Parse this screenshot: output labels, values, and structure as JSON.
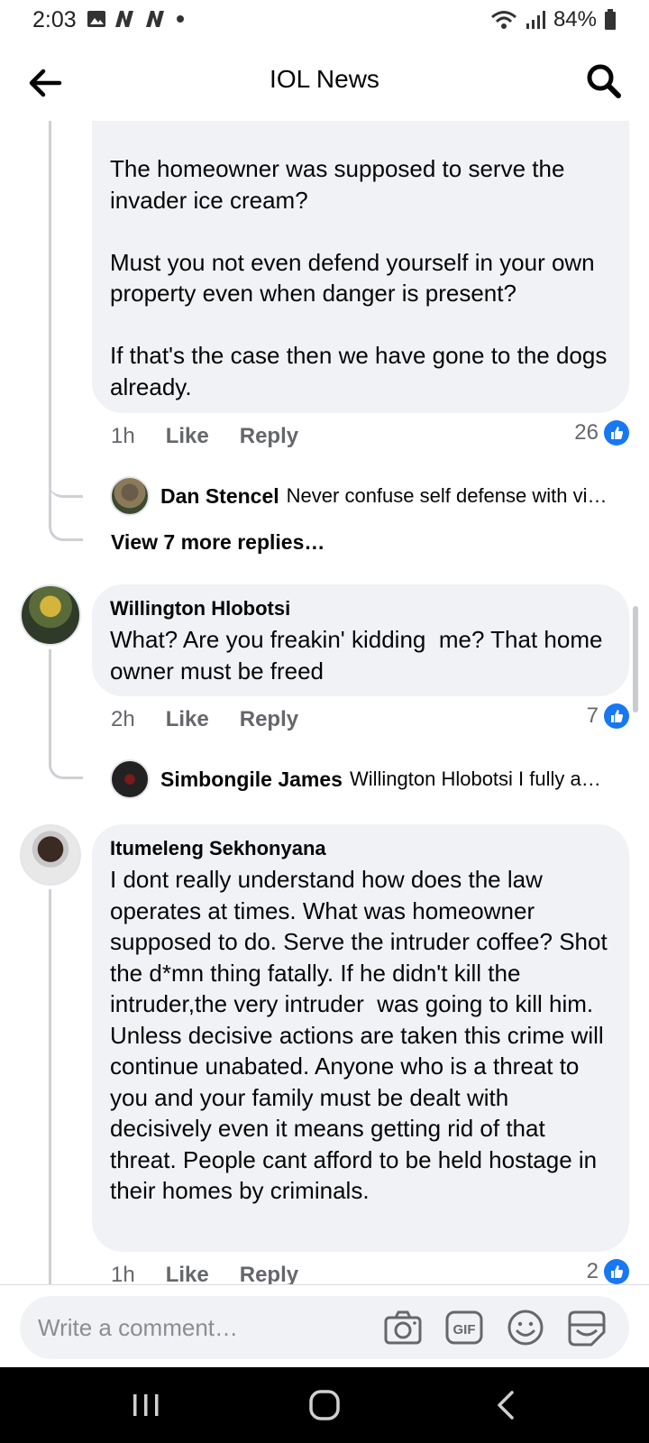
{
  "status_bar": {
    "time": "2:03",
    "battery": "84%"
  },
  "header": {
    "title": "IOL News"
  },
  "comment1": {
    "text": "The homeowner was supposed to serve the invader ice cream?\n\nMust you not even defend yourself in your own property even when danger is present?\n\nIf that's the case then we have gone to the dogs already.",
    "time": "1h",
    "like": "Like",
    "reply": "Reply",
    "reactions": "26",
    "reply_preview": {
      "name": "Dan Stencel",
      "text": "Never confuse self defense with vi…"
    },
    "view_more": "View 7 more replies…"
  },
  "comment2": {
    "name": "Willington Hlobotsi",
    "text": "What? Are you freakin' kidding  me? That home owner must be freed",
    "time": "2h",
    "like": "Like",
    "reply": "Reply",
    "reactions": "7",
    "reply_preview": {
      "name": "Simbongile James",
      "text": "Willington Hlobotsi I fully a…"
    }
  },
  "comment3": {
    "name": "Itumeleng Sekhonyana",
    "text": "I dont really understand how does the law operates at times. What was homeowner supposed to do. Serve the intruder coffee? Shot the d*mn thing fatally. If he didn't kill the intruder,the very intruder  was going to kill him. Unless decisive actions are taken this crime will continue unabated. Anyone who is a threat to you and your family must be dealt with decisively even it means getting rid of that threat. People cant afford to be held hostage in their homes by criminals.",
    "time": "1h",
    "like": "Like",
    "reply": "Reply",
    "reactions": "2"
  },
  "composer": {
    "placeholder": "Write a comment…"
  },
  "colors": {
    "accent": "#1877f2",
    "bubble": "#f0f2f5",
    "muted": "#65676b"
  },
  "icons": [
    "back-arrow-icon",
    "search-icon",
    "camera-icon",
    "gif-icon",
    "emoji-icon",
    "sticker-icon",
    "recents-icon",
    "home-icon",
    "back-nav-icon"
  ]
}
